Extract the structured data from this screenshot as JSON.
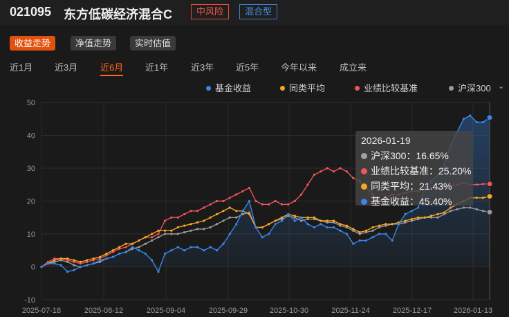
{
  "header": {
    "fund_code": "021095",
    "fund_name": "东方低碳经济混合C",
    "risk_badge": "中风险",
    "type_badge": "混合型"
  },
  "view_tabs": [
    "收益走势",
    "净值走势",
    "实时估值"
  ],
  "periods": [
    "近1月",
    "近3月",
    "近6月",
    "近1年",
    "近3年",
    "近5年",
    "今年以来",
    "成立来"
  ],
  "active_period": "近6月",
  "legend": [
    {
      "label": "基金收益",
      "color": "#3a86e8"
    },
    {
      "label": "同类平均",
      "color": "#f5a623"
    },
    {
      "label": "业绩比较基准",
      "color": "#f0555a"
    },
    {
      "label": "沪深300",
      "color": "#9a9a9a"
    }
  ],
  "tooltip": {
    "date": "2026-01-19",
    "rows": [
      {
        "label": "沪深300：16.65%",
        "color": "#a0a0a0"
      },
      {
        "label": "业绩比较基准：25.20%",
        "color": "#f0555a"
      },
      {
        "label": "同类平均：21.43%",
        "color": "#f5a623"
      },
      {
        "label": "基金收益：45.40%",
        "color": "#3a86e8"
      }
    ]
  },
  "chart_data": {
    "type": "line",
    "x_ticks": [
      "2025-07-18",
      "2025-08-12",
      "2025-09-04",
      "2025-09-29",
      "2025-10-30",
      "2025-11-24",
      "2025-12-17",
      "2026-01-13"
    ],
    "y_ticks": [
      50,
      40,
      30,
      20,
      10,
      0,
      -10
    ],
    "ylim": [
      -10,
      50
    ],
    "grid": true,
    "legend_position": "top-right",
    "series": [
      {
        "name": "沪深300",
        "color": "#9a9a9a",
        "values": [
          0,
          1,
          1.5,
          2,
          1.5,
          0.5,
          0,
          0.5,
          1,
          1.5,
          2.5,
          3,
          4,
          4.5,
          5.5,
          6,
          7,
          8,
          9,
          10,
          10,
          10,
          10.5,
          11,
          11.5,
          11.5,
          12,
          13,
          14,
          15,
          15,
          16,
          16.5,
          12,
          12,
          13,
          14,
          14.5,
          15.5,
          15,
          14,
          14.5,
          14.5,
          14,
          13.5,
          13.5,
          12.5,
          12,
          11,
          10,
          10.5,
          11,
          12,
          12.5,
          13,
          13,
          13.5,
          14,
          14.5,
          15,
          15,
          15,
          16,
          17,
          17.5,
          18,
          18,
          17.5,
          17,
          16.65
        ]
      },
      {
        "name": "业绩比较基准",
        "color": "#f0555a",
        "values": [
          0,
          1.5,
          2.5,
          2.5,
          2,
          1.5,
          1,
          1.5,
          2,
          2.5,
          3.5,
          4.5,
          5.5,
          6,
          7,
          8,
          9,
          9,
          10,
          14,
          15,
          15,
          16,
          17,
          17,
          18,
          19,
          20,
          20,
          21,
          22,
          23,
          24,
          20,
          19,
          19,
          20,
          19,
          19,
          20,
          22,
          25,
          28,
          29,
          30,
          29,
          30,
          29,
          27,
          26,
          24,
          22,
          20,
          21,
          22,
          22,
          22.5,
          23,
          23,
          23.5,
          24,
          24,
          24.5,
          24.5,
          25,
          25.5,
          25,
          25,
          25.2,
          25.2
        ]
      },
      {
        "name": "同类平均",
        "color": "#f5a623",
        "values": [
          0,
          1,
          2,
          2.5,
          2.5,
          2,
          1.5,
          2,
          2.5,
          3,
          4,
          5,
          6,
          7,
          7,
          8,
          9,
          10,
          11,
          11,
          11,
          12,
          12.5,
          13,
          13.5,
          14,
          15,
          16,
          17,
          18,
          17,
          17,
          16,
          12,
          12,
          13,
          14,
          15,
          16,
          15.5,
          15,
          15,
          15,
          14,
          14,
          14,
          13,
          12.5,
          11.5,
          10.5,
          11,
          12,
          12.5,
          13,
          13,
          13.5,
          14,
          14.5,
          15,
          15,
          15.5,
          16,
          16.5,
          18,
          19,
          20,
          21,
          21,
          21,
          21.43
        ]
      },
      {
        "name": "基金收益",
        "color": "#3a86e8",
        "values": [
          0,
          1,
          1,
          0.5,
          -1.5,
          -1,
          0,
          0.5,
          1,
          2,
          2.5,
          3,
          4,
          4.5,
          6,
          5,
          4,
          2,
          -1.5,
          4,
          5,
          6,
          5,
          6,
          6,
          5,
          6,
          5,
          7,
          10,
          13,
          17,
          20,
          12,
          9,
          10,
          13,
          14,
          16,
          14,
          15,
          13,
          12,
          13,
          12,
          12,
          11,
          10,
          7,
          8,
          8,
          9,
          10,
          10,
          8,
          13,
          16,
          17,
          18,
          24,
          26,
          28,
          31,
          37,
          41,
          45,
          46,
          44,
          44,
          45.4
        ]
      }
    ]
  }
}
